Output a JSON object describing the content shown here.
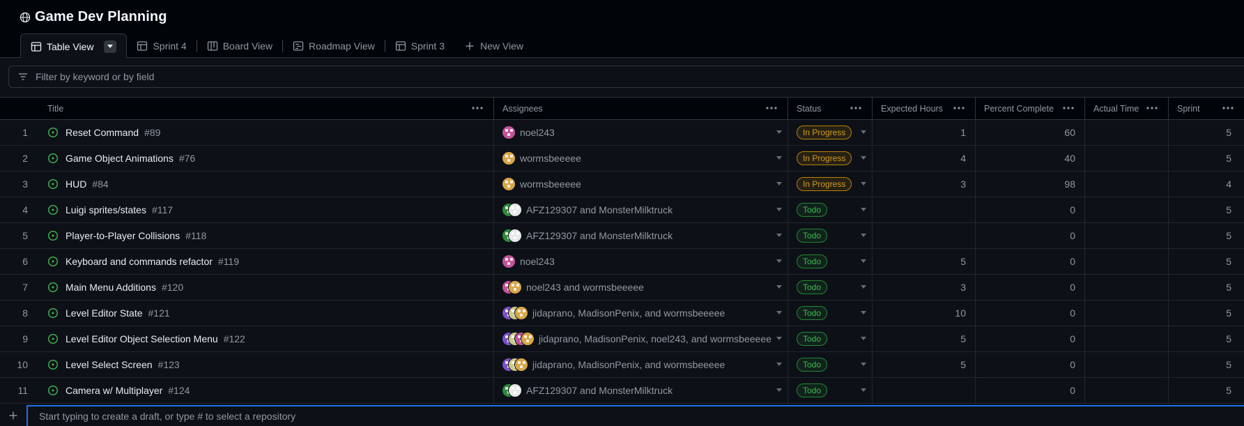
{
  "project": {
    "title": "Game Dev Planning"
  },
  "tabs": [
    {
      "label": "Table View",
      "icon": "table-icon",
      "active": true
    },
    {
      "label": "Sprint 4",
      "icon": "table-icon"
    },
    {
      "label": "Board View",
      "icon": "board-icon"
    },
    {
      "label": "Roadmap View",
      "icon": "roadmap-icon"
    },
    {
      "label": "Sprint 3",
      "icon": "table-icon"
    },
    {
      "label": "New View",
      "icon": "plus-icon"
    }
  ],
  "filter": {
    "placeholder": "Filter by keyword or by field"
  },
  "columns": {
    "title": "Title",
    "assignees": "Assignees",
    "status": "Status",
    "expected_hours": "Expected Hours",
    "percent_complete": "Percent Complete",
    "actual_time": "Actual Time",
    "sprint": "Sprint"
  },
  "colors": {
    "in_progress": "#d29922",
    "todo": "#3fb950",
    "accent": "#1f6feb",
    "open_issue": "#3fb950"
  },
  "rows": [
    {
      "num": "1",
      "title": "Reset Command",
      "issue": "#89",
      "assignees": "noel243",
      "avatars": [
        "noel243"
      ],
      "status": "In Progress",
      "expected": "1",
      "percent": "60",
      "actual": "",
      "sprint": "5"
    },
    {
      "num": "2",
      "title": "Game Object Animations",
      "issue": "#76",
      "assignees": "wormsbeeeee",
      "avatars": [
        "wormsbeeeee"
      ],
      "status": "In Progress",
      "expected": "4",
      "percent": "40",
      "actual": "",
      "sprint": "5"
    },
    {
      "num": "3",
      "title": "HUD",
      "issue": "#84",
      "assignees": "wormsbeeeee",
      "avatars": [
        "wormsbeeeee"
      ],
      "status": "In Progress",
      "expected": "3",
      "percent": "98",
      "actual": "",
      "sprint": "4"
    },
    {
      "num": "4",
      "title": "Luigi sprites/states",
      "issue": "#117",
      "assignees": "AFZ129307 and MonsterMilktruck",
      "avatars": [
        "AFZ129307",
        "MonsterMilktruck"
      ],
      "status": "Todo",
      "expected": "",
      "percent": "0",
      "actual": "",
      "sprint": "5"
    },
    {
      "num": "5",
      "title": "Player-to-Player Collisions",
      "issue": "#118",
      "assignees": "AFZ129307 and MonsterMilktruck",
      "avatars": [
        "AFZ129307",
        "MonsterMilktruck"
      ],
      "status": "Todo",
      "expected": "",
      "percent": "0",
      "actual": "",
      "sprint": "5"
    },
    {
      "num": "6",
      "title": "Keyboard and commands refactor",
      "issue": "#119",
      "assignees": "noel243",
      "avatars": [
        "noel243"
      ],
      "status": "Todo",
      "expected": "5",
      "percent": "0",
      "actual": "",
      "sprint": "5"
    },
    {
      "num": "7",
      "title": "Main Menu Additions",
      "issue": "#120",
      "assignees": "noel243 and wormsbeeeee",
      "avatars": [
        "noel243",
        "wormsbeeeee"
      ],
      "status": "Todo",
      "expected": "3",
      "percent": "0",
      "actual": "",
      "sprint": "5"
    },
    {
      "num": "8",
      "title": "Level Editor State",
      "issue": "#121",
      "assignees": "jidaprano, MadisonPenix, and wormsbeeeee",
      "avatars": [
        "jidaprano",
        "MadisonPenix",
        "wormsbeeeee"
      ],
      "status": "Todo",
      "expected": "10",
      "percent": "0",
      "actual": "",
      "sprint": "5"
    },
    {
      "num": "9",
      "title": "Level Editor Object Selection Menu",
      "issue": "#122",
      "assignees": "jidaprano, MadisonPenix, noel243, and wormsbeeeee",
      "avatars": [
        "jidaprano",
        "MadisonPenix",
        "noel243",
        "wormsbeeeee"
      ],
      "status": "Todo",
      "expected": "5",
      "percent": "0",
      "actual": "",
      "sprint": "5"
    },
    {
      "num": "10",
      "title": "Level Select Screen",
      "issue": "#123",
      "assignees": "jidaprano, MadisonPenix, and wormsbeeeee",
      "avatars": [
        "jidaprano",
        "MadisonPenix",
        "wormsbeeeee"
      ],
      "status": "Todo",
      "expected": "5",
      "percent": "0",
      "actual": "",
      "sprint": "5"
    },
    {
      "num": "11",
      "title": "Camera w/ Multiplayer",
      "issue": "#124",
      "assignees": "AFZ129307 and MonsterMilktruck",
      "avatars": [
        "AFZ129307",
        "MonsterMilktruck"
      ],
      "status": "Todo",
      "expected": "",
      "percent": "0",
      "actual": "",
      "sprint": "5"
    }
  ],
  "draft": {
    "placeholder": "Start typing to create a draft, or type # to select a repository"
  }
}
